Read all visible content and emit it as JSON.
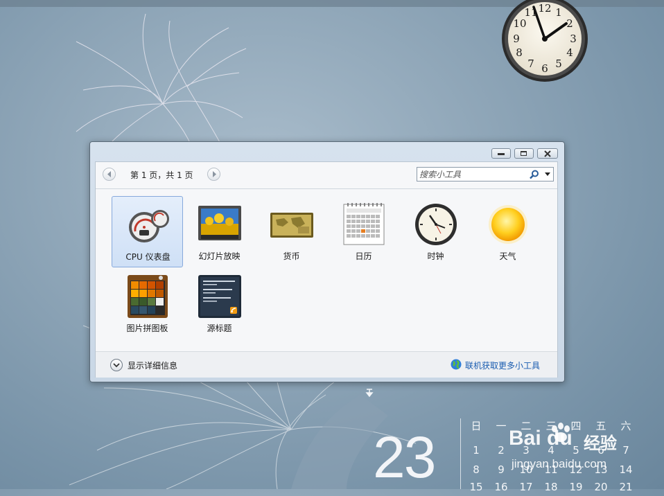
{
  "desktop": {
    "clock_numerals": [
      "12",
      "1",
      "2",
      "3",
      "4",
      "5",
      "6",
      "7",
      "8",
      "9",
      "10",
      "11"
    ],
    "date_day": "23",
    "calendar": {
      "weekdays": [
        "日",
        "一",
        "二",
        "三",
        "四",
        "五",
        "六"
      ],
      "rows": [
        [
          "1",
          "2",
          "3",
          "4",
          "5",
          "6",
          "7"
        ],
        [
          "8",
          "9",
          "10",
          "11",
          "12",
          "13",
          "14"
        ],
        [
          "15",
          "16",
          "17",
          "18",
          "19",
          "20",
          "21"
        ]
      ]
    },
    "watermark": {
      "brand": "Bai du",
      "text": "经验",
      "url": "jingyan.baidu.com"
    }
  },
  "gadget_window": {
    "pager": {
      "label": "第 1 页，共 1 页"
    },
    "search": {
      "placeholder": "搜索小工具"
    },
    "gadgets": [
      {
        "label": "CPU 仪表盘",
        "icon": "cpu-meter-icon",
        "selected": true
      },
      {
        "label": "幻灯片放映",
        "icon": "slideshow-icon"
      },
      {
        "label": "货币",
        "icon": "currency-icon"
      },
      {
        "label": "日历",
        "icon": "calendar-icon"
      },
      {
        "label": "时钟",
        "icon": "clock-icon"
      },
      {
        "label": "天气",
        "icon": "weather-sun-icon"
      },
      {
        "label": "图片拼图板",
        "icon": "picture-puzzle-icon"
      },
      {
        "label": "源标题",
        "icon": "feed-headlines-icon"
      }
    ],
    "footer": {
      "details_label": "显示详细信息",
      "online_link": "联机获取更多小工具"
    }
  },
  "colors": {
    "desktop_bg": "#8fa6b8",
    "link": "#1a5cb0",
    "selected_bg": "#cfe0f6"
  }
}
